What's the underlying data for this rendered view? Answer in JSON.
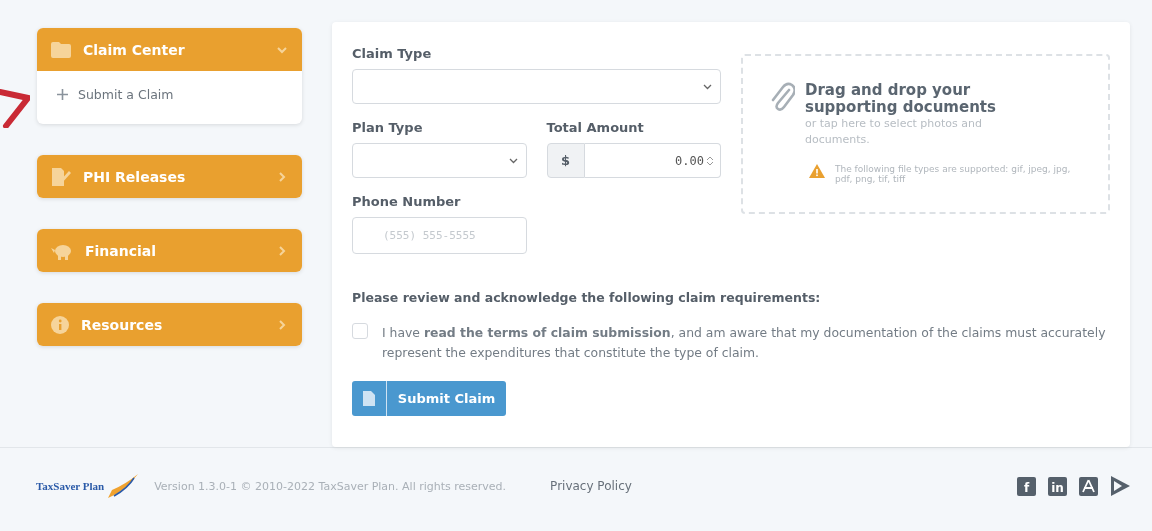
{
  "sidebar": {
    "items": [
      {
        "label": "Claim Center",
        "expanded": true,
        "children": [
          {
            "label": "Submit a Claim"
          }
        ]
      },
      {
        "label": "PHI Releases",
        "expanded": false
      },
      {
        "label": "Financial",
        "expanded": false
      },
      {
        "label": "Resources",
        "expanded": false
      }
    ]
  },
  "form": {
    "claim_type": {
      "label": "Claim Type"
    },
    "plan_type": {
      "label": "Plan Type"
    },
    "total_amount": {
      "label": "Total Amount",
      "prefix": "$",
      "value": "0.00"
    },
    "phone_number": {
      "label": "Phone Number",
      "placeholder": "(555) 555-5555"
    },
    "upload": {
      "title": "Drag and drop your supporting documents",
      "subtitle": "or tap here to select photos and documents.",
      "note": "The following file types are supported: gif, jpeg, jpg, pdf, png, tif, tiff"
    },
    "requirements_heading": "Please review and acknowledge the following claim requirements:",
    "acknowledgement": {
      "checked": false,
      "text": "I have **read the terms of claim submission**, and am aware that my documentation of the claims must accurately represent the expenditures that constitute the type of claim."
    },
    "submit_button": "Submit Claim"
  },
  "footer": {
    "logo": "TaxSaver Plan",
    "copyright": "Version 1.3.0-1 © 2010-2022 TaxSaver Plan. All rights reserved.",
    "privacy_link": "Privacy Policy",
    "social": [
      {
        "kind": "facebook",
        "glyph": "f"
      },
      {
        "kind": "linkedin",
        "glyph": "in"
      },
      {
        "kind": "appstore"
      },
      {
        "kind": "play"
      }
    ]
  }
}
